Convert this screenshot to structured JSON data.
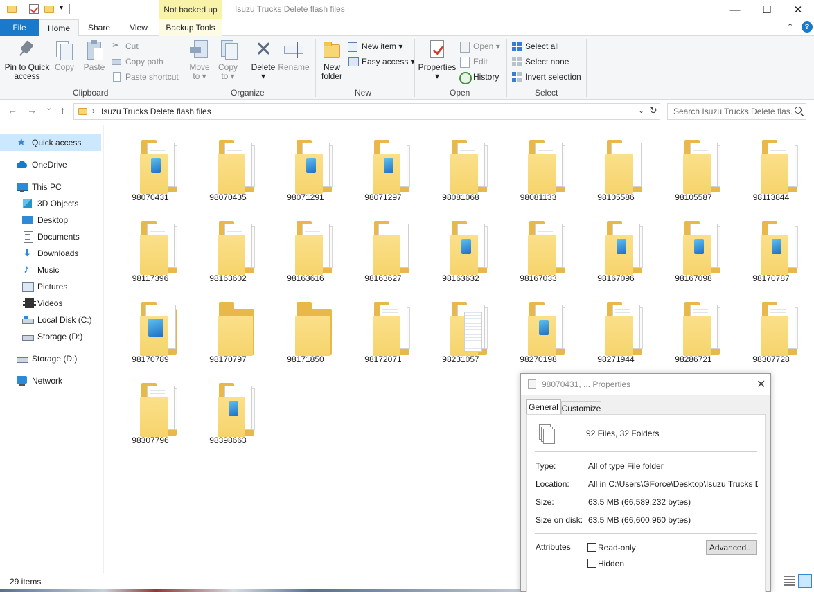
{
  "titlebar": {
    "contextual_tab_label": "Not backed up",
    "window_title": "Isuzu Trucks Delete flash files",
    "minimize_glyph": "—",
    "maximize_glyph": "☐",
    "close_glyph": "✕",
    "qat_arrow": "▾"
  },
  "tabs": {
    "file": "File",
    "home": "Home",
    "share": "Share",
    "view": "View",
    "backup_tools": "Backup Tools",
    "collapse_glyph": "⌃",
    "help_glyph": "?"
  },
  "ribbon": {
    "clipboard": {
      "group_label": "Clipboard",
      "pin_label_1": "Pin to Quick",
      "pin_label_2": "access",
      "copy": "Copy",
      "paste": "Paste",
      "cut": "Cut",
      "copy_path": "Copy path",
      "paste_shortcut": "Paste shortcut"
    },
    "organize": {
      "group_label": "Organize",
      "move_to_1": "Move",
      "move_to_2": "to ▾",
      "copy_to_1": "Copy",
      "copy_to_2": "to ▾",
      "delete_1": "Delete",
      "delete_2": "▾",
      "rename": "Rename"
    },
    "new": {
      "group_label": "New",
      "new_folder_1": "New",
      "new_folder_2": "folder",
      "new_item": "New item ▾",
      "easy_access": "Easy access ▾"
    },
    "open": {
      "group_label": "Open",
      "properties_1": "Properties",
      "properties_2": "▾",
      "open": "Open ▾",
      "edit": "Edit",
      "history": "History"
    },
    "select": {
      "group_label": "Select",
      "select_all": "Select all",
      "select_none": "Select none",
      "invert_selection": "Invert selection"
    }
  },
  "addressbar": {
    "back_glyph": "←",
    "forward_glyph": "→",
    "recent_glyph": "⌄",
    "up_glyph": "↑",
    "separator": "›",
    "path": "Isuzu Trucks Delete flash files",
    "dropdown_glyph": "⌄",
    "refresh_glyph": "↻",
    "search_placeholder": "Search Isuzu Trucks Delete flas..."
  },
  "navpane": {
    "items": [
      {
        "label": "Quick access",
        "icon": "star-icon"
      },
      {
        "label": "OneDrive",
        "icon": "cloud-icon"
      },
      {
        "label": "This PC",
        "icon": "monitor-icon"
      },
      {
        "label": "3D Objects",
        "icon": "cube-icon"
      },
      {
        "label": "Desktop",
        "icon": "desktop-icon"
      },
      {
        "label": "Documents",
        "icon": "documents-icon"
      },
      {
        "label": "Downloads",
        "icon": "downloads-icon"
      },
      {
        "label": "Music",
        "icon": "music-icon"
      },
      {
        "label": "Pictures",
        "icon": "pictures-icon"
      },
      {
        "label": "Videos",
        "icon": "videos-icon"
      },
      {
        "label": "Local Disk (C:)",
        "icon": "drive-icon"
      },
      {
        "label": "Storage (D:)",
        "icon": "drive-icon"
      },
      {
        "label": "Storage (D:)",
        "icon": "drive-icon"
      },
      {
        "label": "Network",
        "icon": "network-icon"
      }
    ]
  },
  "files": [
    {
      "name": "98070431",
      "style": "papers-pic"
    },
    {
      "name": "98070435",
      "style": "papers"
    },
    {
      "name": "98071291",
      "style": "pics"
    },
    {
      "name": "98071297",
      "style": "pics"
    },
    {
      "name": "98081068",
      "style": "papers"
    },
    {
      "name": "98081133",
      "style": "papers"
    },
    {
      "name": "98105586",
      "style": "paper"
    },
    {
      "name": "98105587",
      "style": "papers"
    },
    {
      "name": "98113844",
      "style": "papers"
    },
    {
      "name": "98117396",
      "style": "papers"
    },
    {
      "name": "98163602",
      "style": "papers"
    },
    {
      "name": "98163616",
      "style": "papers"
    },
    {
      "name": "98163627",
      "style": "paper"
    },
    {
      "name": "98163632",
      "style": "pics"
    },
    {
      "name": "98167033",
      "style": "papers"
    },
    {
      "name": "98167096",
      "style": "pics"
    },
    {
      "name": "98167098",
      "style": "pics"
    },
    {
      "name": "98170787",
      "style": "pics"
    },
    {
      "name": "98170789",
      "style": "bigpic"
    },
    {
      "name": "98170797",
      "style": "empty"
    },
    {
      "name": "98171850",
      "style": "empty"
    },
    {
      "name": "98172071",
      "style": "papers"
    },
    {
      "name": "98231057",
      "style": "stack"
    },
    {
      "name": "98270198",
      "style": "pics"
    },
    {
      "name": "98271944",
      "style": "papers"
    },
    {
      "name": "98286721",
      "style": "papers"
    },
    {
      "name": "98307728",
      "style": "papers"
    },
    {
      "name": "98307796",
      "style": "papers"
    },
    {
      "name": "98398663",
      "style": "pics"
    }
  ],
  "statusbar": {
    "item_count": "29 items"
  },
  "properties_dialog": {
    "title": "98070431, ... Properties",
    "close_glyph": "✕",
    "tab_general": "General",
    "tab_customize": "Customize",
    "summary": "92 Files, 32 Folders",
    "type_label": "Type:",
    "type_value": "All of type File folder",
    "location_label": "Location:",
    "location_value": "All in C:\\Users\\GForce\\Desktop\\Isuzu Trucks Delete",
    "size_label": "Size:",
    "size_value": "63.5 MB (66,589,232 bytes)",
    "size_on_disk_label": "Size on disk:",
    "size_on_disk_value": "63.5 MB (66,600,960 bytes)",
    "attributes_label": "Attributes",
    "readonly_label": "Read-only",
    "hidden_label": "Hidden",
    "advanced_button": "Advanced..."
  }
}
